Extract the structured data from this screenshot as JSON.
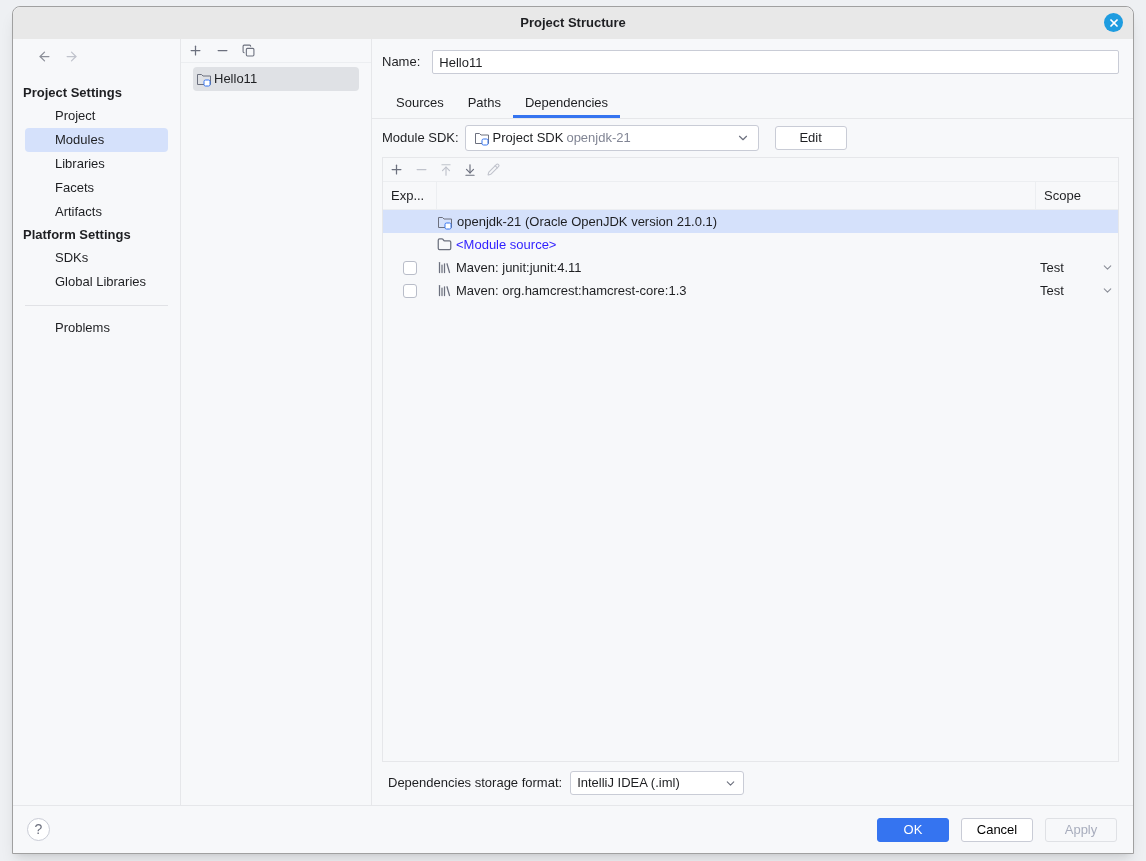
{
  "window": {
    "title": "Project Structure"
  },
  "sidebar": {
    "groups": [
      {
        "title": "Project Settings",
        "items": [
          {
            "label": "Project",
            "selected": false
          },
          {
            "label": "Modules",
            "selected": true
          },
          {
            "label": "Libraries",
            "selected": false
          },
          {
            "label": "Facets",
            "selected": false
          },
          {
            "label": "Artifacts",
            "selected": false
          }
        ]
      },
      {
        "title": "Platform Settings",
        "items": [
          {
            "label": "SDKs",
            "selected": false
          },
          {
            "label": "Global Libraries",
            "selected": false
          }
        ]
      }
    ],
    "footer_items": [
      {
        "label": "Problems",
        "selected": false
      }
    ]
  },
  "modules": [
    {
      "label": "Hello11",
      "selected": true
    }
  ],
  "name_field": {
    "label": "Name:",
    "value": "Hello11"
  },
  "tabs": [
    {
      "label": "Sources",
      "selected": false
    },
    {
      "label": "Paths",
      "selected": false
    },
    {
      "label": "Dependencies",
      "selected": true
    }
  ],
  "module_sdk": {
    "label": "Module SDK:",
    "value": "Project SDK",
    "hint": "openjdk-21",
    "edit_button": "Edit"
  },
  "table": {
    "columns": [
      "Exp...",
      "Scope"
    ],
    "rows": [
      {
        "kind": "sdk",
        "name": "openjdk-21 (Oracle OpenJDK version 21.0.1)",
        "selected": true
      },
      {
        "kind": "source",
        "name": "<Module source>",
        "selected": false
      },
      {
        "kind": "library",
        "name": "Maven: junit:junit:4.11",
        "checked": false,
        "scope": "Test",
        "selected": false
      },
      {
        "kind": "library",
        "name": "Maven: org.hamcrest:hamcrest-core:1.3",
        "checked": false,
        "scope": "Test",
        "selected": false
      }
    ]
  },
  "storage_format": {
    "label": "Dependencies storage format:",
    "value": "IntelliJ IDEA (.iml)"
  },
  "help": "?",
  "buttons": [
    {
      "label": "OK",
      "kind": "primary",
      "disabled": false
    },
    {
      "label": "Cancel",
      "kind": "normal",
      "disabled": false
    },
    {
      "label": "Apply",
      "kind": "normal",
      "disabled": true
    }
  ]
}
